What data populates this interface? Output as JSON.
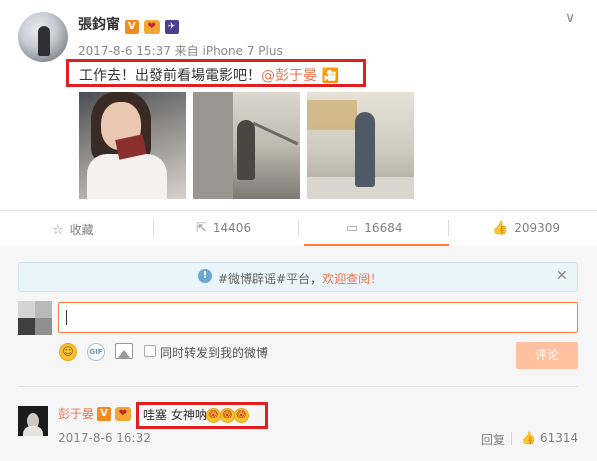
{
  "post": {
    "username": "張鈞甯",
    "badges": [
      "verified-v-icon",
      "heart-badge-icon",
      "rocket-badge-icon"
    ],
    "meta": "2017-8-6 15:37 来自 iPhone 7 Plus",
    "text_main": "工作去！出發前看場電影吧！",
    "mention": "@彭于晏",
    "emoji": "cinema-emoji",
    "photos": [
      "photo-holding-tickets",
      "photo-stairs",
      "photo-mall-walk"
    ]
  },
  "actions": {
    "favorite": {
      "label": "收藏",
      "icon": "star-icon"
    },
    "repost": {
      "count": "14406",
      "icon": "repost-icon"
    },
    "comment": {
      "count": "16684",
      "icon": "comment-icon"
    },
    "like": {
      "count": "209309",
      "icon": "thumbs-up-icon"
    }
  },
  "notice": {
    "text_prefix": "#微博辟谣#平台，",
    "link": "欢迎查阅！"
  },
  "composer": {
    "input_value": "",
    "repost_checkbox_label": "同时转发到我的微博",
    "repost_checked": false,
    "submit_label": "评论"
  },
  "comment": {
    "username": "彭于晏",
    "text": "哇塞 女神呐",
    "emojis": 3,
    "time": "2017-8-6 16:32",
    "reply_label": "回复",
    "like_count": "61314"
  },
  "colors": {
    "accent": "#eb7350",
    "active_underline": "#fa7d3c",
    "highlight_box": "#e02020",
    "notice_bg": "#eaf4fb"
  }
}
